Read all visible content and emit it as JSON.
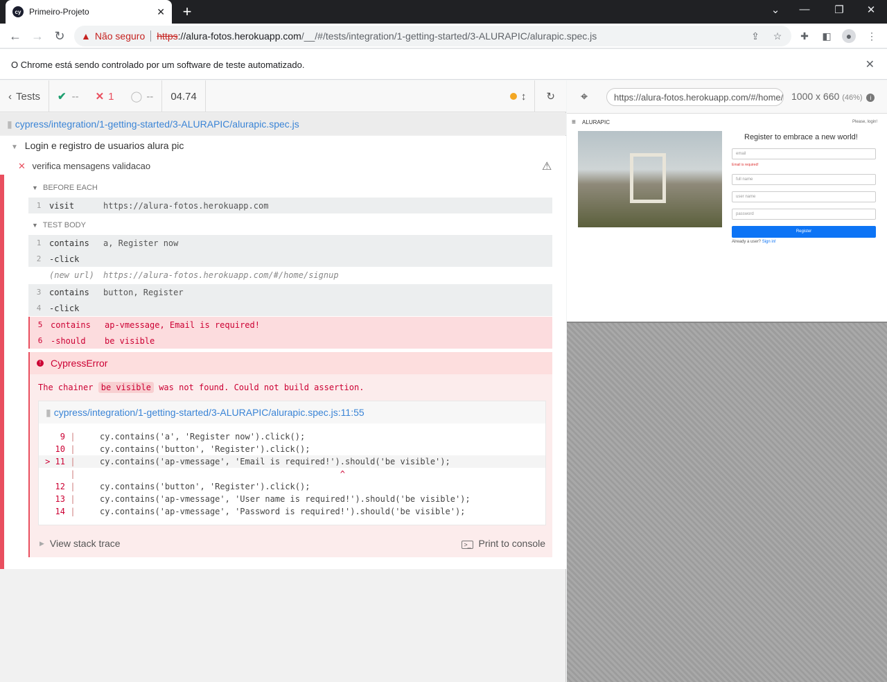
{
  "browser": {
    "tab_title": "Primeiro-Projeto",
    "tab_favicon": "cy",
    "insecure_label": "Não seguro",
    "url_proto": "https",
    "url_host": "://alura-fotos.herokuapp.com",
    "url_path": "/__/#/tests/integration/1-getting-started/3-ALURAPIC/alurapic.spec.js",
    "infobar_text": "O Chrome está sendo controlado por um software de teste automatizado."
  },
  "reporter": {
    "tests_label": "Tests",
    "passed": "--",
    "failed": "1",
    "pending": "--",
    "duration": "04.74",
    "spec_path": "cypress/integration/1-getting-started/3-ALURAPIC/alurapic.spec.js",
    "suite_title": "Login e registro de usuarios alura pic",
    "test_title": "verifica mensagens validacao",
    "before_each_label": "BEFORE EACH",
    "test_body_label": "TEST BODY",
    "before_each": [
      {
        "num": "1",
        "name": "visit",
        "message": "https://alura-fotos.herokuapp.com"
      }
    ],
    "commands": [
      {
        "num": "1",
        "name": "contains",
        "message": "a, Register now"
      },
      {
        "num": "2",
        "name": "-click",
        "message": ""
      },
      {
        "num": "",
        "name": "(new url)",
        "message": "https://alura-fotos.herokuapp.com/#/home/signup"
      },
      {
        "num": "3",
        "name": "contains",
        "message": "button, Register"
      },
      {
        "num": "4",
        "name": "-click",
        "message": ""
      },
      {
        "num": "5",
        "name": "contains",
        "message": "ap-vmessage, Email is required!"
      },
      {
        "num": "6",
        "name": "-should",
        "message": "be visible"
      }
    ],
    "error": {
      "name": "CypressError",
      "msg_pre": "The chainer",
      "msg_code": "be visible",
      "msg_post": "was not found. Could not build assertion.",
      "file_link": "cypress/integration/1-getting-started/3-ALURAPIC/alurapic.spec.js:11:55",
      "code_lines": [
        {
          "ln": "9",
          "text": "cy.contains('a', 'Register now').click();"
        },
        {
          "ln": "10",
          "text": "cy.contains('button', 'Register').click();"
        },
        {
          "ln": "> 11",
          "text": "cy.contains('ap-vmessage', 'Email is required!').should('be visible');"
        },
        {
          "ln": "",
          "text": "                                                ^"
        },
        {
          "ln": "12",
          "text": "cy.contains('button', 'Register').click();"
        },
        {
          "ln": "13",
          "text": "cy.contains('ap-vmessage', 'User name is required!').should('be visible');"
        },
        {
          "ln": "14",
          "text": "cy.contains('ap-vmessage', 'Password is required!').should('be visible');"
        }
      ],
      "view_stack": "View stack trace",
      "print_console": "Print to console"
    }
  },
  "aut": {
    "url": "https://alura-fotos.herokuapp.com/#/home/signup",
    "size": "1000 x 660",
    "scale": "(46%)",
    "app": {
      "brand": "ALURAPIC",
      "login_link": "Please, login!",
      "heading": "Register to embrace a new world!",
      "email_ph": "email",
      "email_error": "Email is required!",
      "fullname_ph": "full name",
      "username_ph": "user name",
      "password_ph": "password",
      "register_btn": "Register",
      "already_user": "Already a user?",
      "sign_in": "Sign in!"
    }
  }
}
